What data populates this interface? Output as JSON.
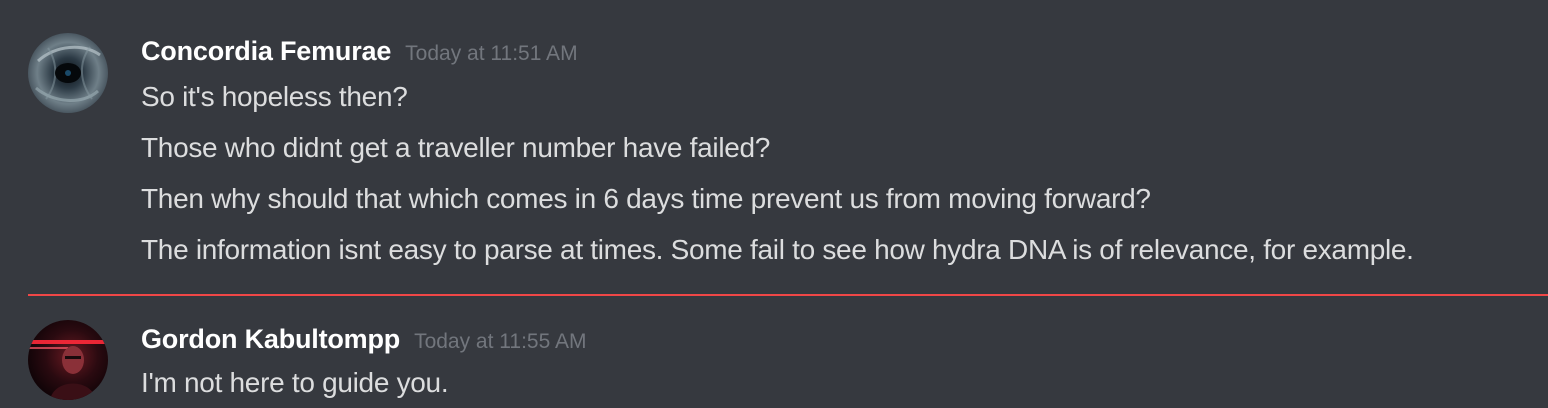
{
  "messages": [
    {
      "author": "Concordia Femurae",
      "timestamp": "Today at 11:51 AM",
      "avatar_icon": "dark-vortex-avatar-icon",
      "lines": [
        "So it's hopeless then?",
        "Those who didnt get a traveller number have failed?",
        "Then why should that which comes in 6 days time prevent us from moving forward?",
        "The information isnt easy to parse at times. Some fail to see how hydra DNA is of relevance, for example."
      ]
    },
    {
      "author": "Gordon Kabultompp",
      "timestamp": "Today at 11:55 AM",
      "avatar_icon": "red-neon-portrait-avatar-icon",
      "lines": [
        "I'm not here to guide you."
      ]
    }
  ],
  "colors": {
    "background": "#36393f",
    "username": "#ffffff",
    "message_text": "#dcddde",
    "timestamp": "#72767d",
    "new_messages_divider": "#f04747"
  }
}
